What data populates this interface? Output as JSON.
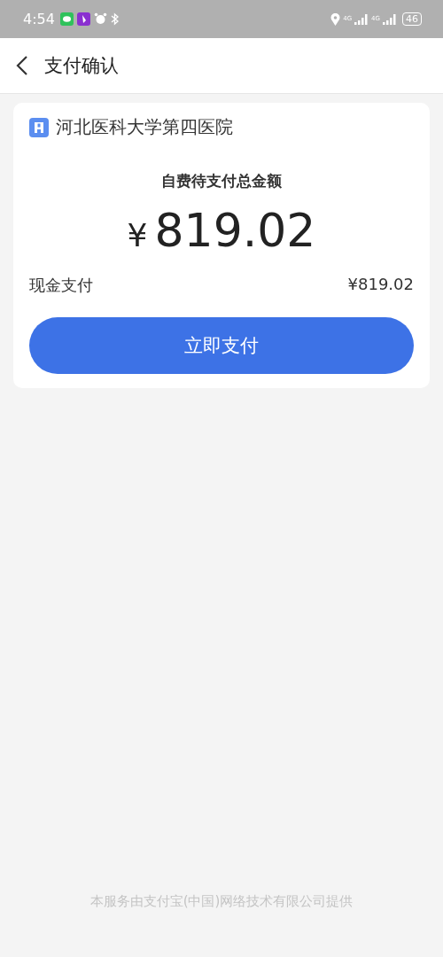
{
  "status_bar": {
    "time": "4:54",
    "network_1": "4G",
    "network_2": "4G",
    "battery": "46"
  },
  "header": {
    "title": "支付确认"
  },
  "card": {
    "hospital": "河北医科大学第四医院",
    "amount_label": "自费待支付总金额",
    "currency": "¥",
    "amount": "819.02",
    "payment_method": "现金支付",
    "payment_amount": "¥819.02",
    "pay_button": "立即支付"
  },
  "footer": "本服务由支付宝(中国)网络技术有限公司提供"
}
